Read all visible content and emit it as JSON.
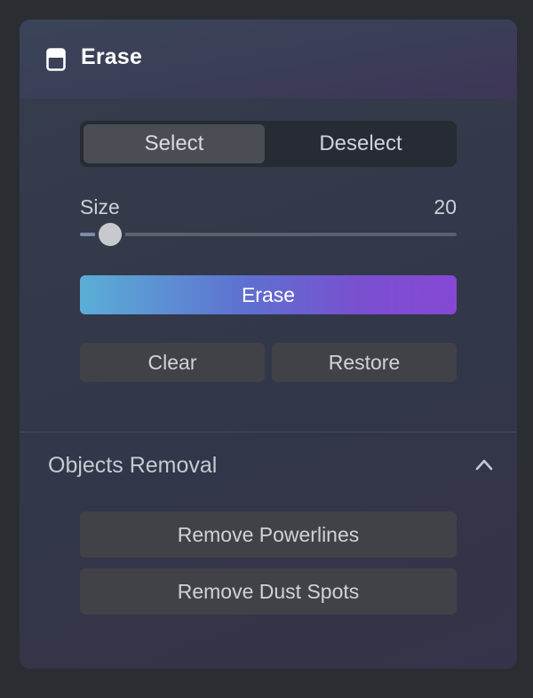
{
  "panel": {
    "title": "Erase",
    "icon": "eraser-icon"
  },
  "mode_toggle": {
    "options": [
      "Select",
      "Deselect"
    ],
    "selected": "Select"
  },
  "size": {
    "label": "Size",
    "value": "20",
    "slider_fraction": 0.08
  },
  "actions": {
    "erase_label": "Erase",
    "clear_label": "Clear",
    "restore_label": "Restore"
  },
  "objects_removal": {
    "title": "Objects Removal",
    "collapse_icon": "chevron-up-icon",
    "buttons": [
      "Remove Powerlines",
      "Remove Dust Spots"
    ]
  },
  "colors": {
    "erase_gradient_start": "#5aaed6",
    "erase_gradient_end": "#8648d4",
    "panel_background": "#343a4a"
  }
}
